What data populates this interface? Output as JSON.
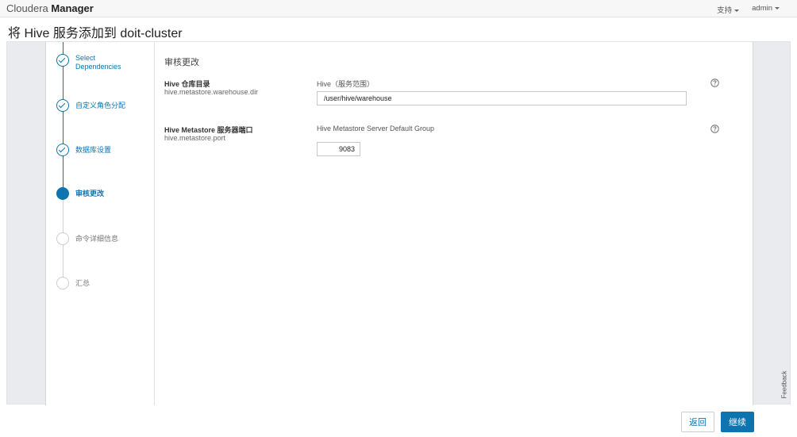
{
  "header": {
    "brand_prefix": "Cloudera",
    "brand_strong": "Manager",
    "nav": [
      {
        "label": "支持"
      },
      {
        "label": "admin"
      }
    ]
  },
  "page": {
    "title": "将 Hive 服务添加到 doit-cluster"
  },
  "wizard": {
    "steps": [
      {
        "label": "Select Dependencies",
        "state": "done"
      },
      {
        "label": "自定义角色分配",
        "state": "done"
      },
      {
        "label": "数据库设置",
        "state": "done"
      },
      {
        "label": "审核更改",
        "state": "current"
      },
      {
        "label": "命令详细信息",
        "state": "pending"
      },
      {
        "label": "汇总",
        "state": "pending"
      }
    ]
  },
  "content": {
    "section_title": "审核更改",
    "properties": [
      {
        "display_name": "Hive 仓库目录",
        "key": "hive.metastore.warehouse.dir",
        "scope": "Hive（服务范围）",
        "value": "/user/hive/warehouse"
      },
      {
        "display_name": "Hive Metastore 服务器端口",
        "key": "hive.metastore.port",
        "scope": "Hive Metastore Server Default Group",
        "value": "9083"
      }
    ]
  },
  "feedback": {
    "label": "Feedback"
  },
  "footer": {
    "back_label": "返回",
    "continue_label": "继续"
  },
  "colors": {
    "accent": "#0d74b0",
    "panel_bg": "#e9ebee"
  },
  "icons": [
    "check-circle-icon",
    "help-icon",
    "caret-down-icon"
  ]
}
